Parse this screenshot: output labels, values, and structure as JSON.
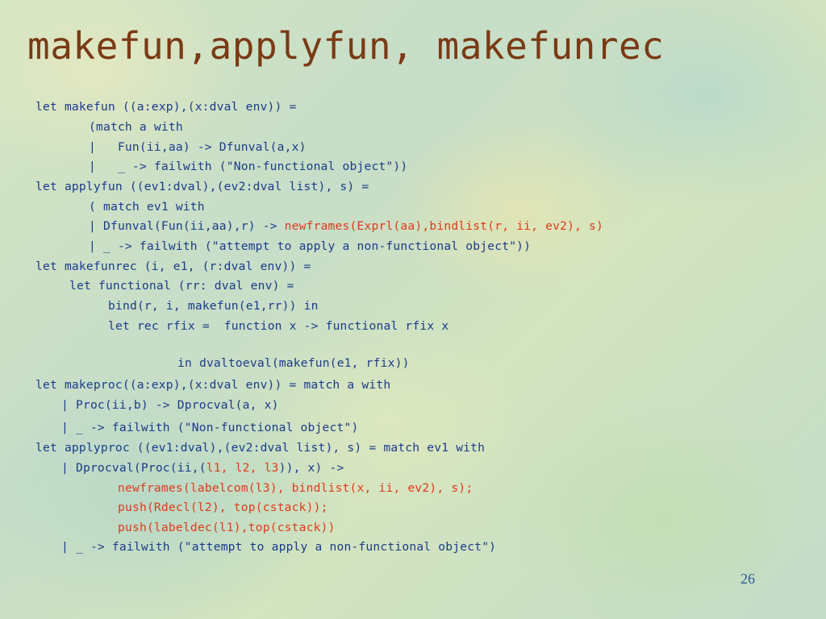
{
  "slide": {
    "title": "makefun,applyfun, makefunrec",
    "page_number": "26",
    "code": {
      "l1": "let makefun ((a:exp),(x:dval env)) =",
      "l2": "(match a with",
      "l3": "|   Fun(ii,aa) -> Dfunval(a,x)",
      "l4": "|   _ -> failwith (\"Non-functional object\"))",
      "l5": "let applyfun ((ev1:dval),(ev2:dval list), s) =",
      "l6": "( match ev1 with",
      "l7a": "| Dfunval(Fun(ii,aa),r) -> ",
      "l7b": "newframes(Exprl(aa),bindlist(r, ii, ev2), s)",
      "l8": "| _ -> failwith (\"attempt to apply a non-functional object\"))",
      "l9": "let makefunrec (i, e1, (r:dval env)) =",
      "l10": "let functional (rr: dval env) =",
      "l11": "bind(r, i, makefun(e1,rr)) in",
      "l12": "let rec rfix =  function x -> functional rfix x",
      "l13": "in dvaltoeval(makefun(e1, rfix))",
      "l14": "let makeproc((a:exp),(x:dval env)) = match a with",
      "l15": "| Proc(ii,b) -> Dprocval(a, x)",
      "l16": "| _ -> failwith (\"Non-functional object\")",
      "l17": "let applyproc ((ev1:dval),(ev2:dval list), s) = match ev1 with",
      "l18a": "| Dprocval(Proc(ii,(",
      "l18b": "l1, l2, l3",
      "l18c": ")), x) ->",
      "l19": "newframes(labelcom(l3), bindlist(x, ii, ev2), s);",
      "l20": "push(Rdecl(l2), top(cstack));",
      "l21": "push(labeldec(l1),top(cstack))",
      "l22": "| _ -> failwith (\"attempt to apply a non-functional object\")"
    },
    "colors": {
      "title": "#7a3a14",
      "code": "#1c3a8a",
      "highlight": "#e03a1a",
      "page_number": "#2b5a94"
    }
  }
}
